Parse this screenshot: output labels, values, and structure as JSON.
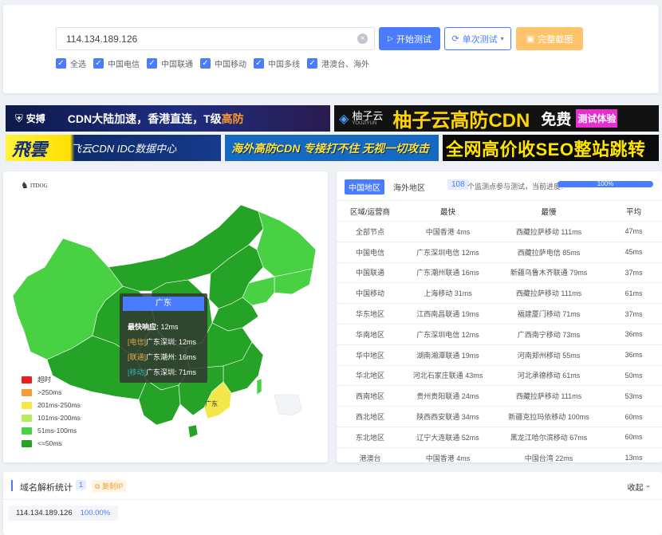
{
  "search": {
    "value": "114.134.189.126",
    "start_label": "开始测试",
    "single_label": "单次测试",
    "screenshot_label": "完整截图",
    "checks": [
      "全选",
      "中国电信",
      "中国联通",
      "中国移动",
      "中国多线",
      "港澳台、海外"
    ]
  },
  "banners": {
    "b1": {
      "brand": "安搏",
      "text": "CDN大陆加速，香港直连，T级",
      "highlight": "高防"
    },
    "b2": {
      "brand": "柚子云",
      "brand_sub": "YOUZIYUN",
      "text": "柚子云高防CDN",
      "free": "免费",
      "trial": "测试体验"
    },
    "b3": {
      "brand": "飛雲",
      "text": "飞云CDN IDC数据中心"
    },
    "b4": {
      "text": "海外高防CDN 专接打不住 无视一切攻击"
    },
    "b5": {
      "text": "全网高价收SEO整站跳转"
    }
  },
  "map": {
    "logo": "ITDOG",
    "tooltip": {
      "region": "广东",
      "fastest_label": "最快响应:",
      "fastest_value": "12ms",
      "lines": [
        {
          "tag": "[电信]",
          "city": "广东深圳:",
          "ms": "12ms",
          "color": "#e3a94c"
        },
        {
          "tag": "[联通]",
          "city": "广东潮州:",
          "ms": "16ms",
          "color": "#e3a94c"
        },
        {
          "tag": "[移动]",
          "city": "广东深圳:",
          "ms": "71ms",
          "color": "#2bb5b5"
        }
      ]
    },
    "region_label": "广东",
    "legend": [
      {
        "label": "超时",
        "color": "#e62020"
      },
      {
        "label": ">250ms",
        "color": "#f89a36"
      },
      {
        "label": "201ms-250ms",
        "color": "#f3e74a"
      },
      {
        "label": "101ms-200ms",
        "color": "#b6ec5a"
      },
      {
        "label": "51ms-100ms",
        "color": "#48d143"
      },
      {
        "label": "<=50ms",
        "color": "#25a326"
      }
    ]
  },
  "table": {
    "tab_active": "中国地区",
    "tab_other": "海外地区",
    "count": "108",
    "progress_text": "个监测点参与测试，当前进度:",
    "progress_value": "100%",
    "progress_fraction": 1.0,
    "headers": [
      "区域/运营商",
      "最快",
      "最慢",
      "平均"
    ],
    "rows": [
      [
        "全部节点",
        "中国香港 4ms",
        "西藏拉萨移动 111ms",
        "47ms"
      ],
      [
        "中国电信",
        "广东深圳电信 12ms",
        "西藏拉萨电信 85ms",
        "45ms"
      ],
      [
        "中国联通",
        "广东潮州联通 16ms",
        "新疆乌鲁木齐联通 79ms",
        "37ms"
      ],
      [
        "中国移动",
        "上海移动 31ms",
        "西藏拉萨移动 111ms",
        "61ms"
      ],
      [
        "华东地区",
        "江西南昌联通 19ms",
        "福建厦门移动 71ms",
        "37ms"
      ],
      [
        "华南地区",
        "广东深圳电信 12ms",
        "广西南宁移动 73ms",
        "36ms"
      ],
      [
        "华中地区",
        "湖南湘潭联通 19ms",
        "河南郑州移动 55ms",
        "36ms"
      ],
      [
        "华北地区",
        "河北石家庄联通 43ms",
        "河北承德移动 61ms",
        "50ms"
      ],
      [
        "西南地区",
        "贵州贵阳联通 24ms",
        "西藏拉萨移动 111ms",
        "53ms"
      ],
      [
        "西北地区",
        "陕西西安联通 34ms",
        "新疆克拉玛依移动 100ms",
        "60ms"
      ],
      [
        "东北地区",
        "辽宁大连联通 52ms",
        "黑龙江哈尔滨移动 67ms",
        "60ms"
      ],
      [
        "港澳台",
        "中国香港 4ms",
        "中国台湾 22ms",
        "13ms"
      ]
    ]
  },
  "dns": {
    "title": "域名解析统计",
    "count": "1",
    "copy_label": "复制IP",
    "collapse_label": "收起",
    "ip": "114.134.189.126",
    "pct": "100.00%"
  },
  "colors": {
    "accent": "#4a7cff",
    "orange": "#ffc36a"
  }
}
